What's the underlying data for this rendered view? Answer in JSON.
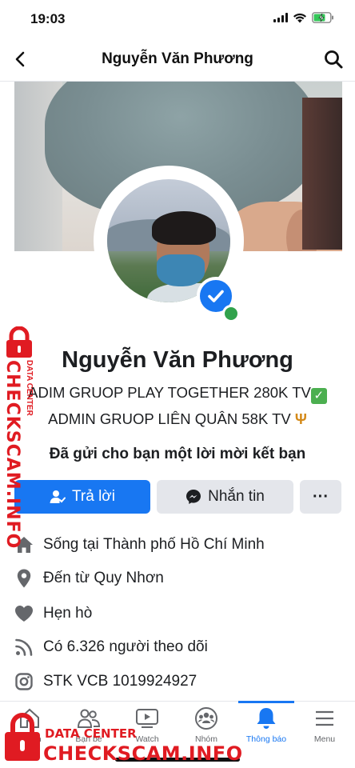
{
  "status_bar": {
    "time": "19:03"
  },
  "nav": {
    "title": "Nguyễn Văn Phương"
  },
  "profile": {
    "name": "Nguyễn Văn Phương",
    "bio_line1": "ADIM GRUOP PLAY TOGETHER 280K TV",
    "bio_line2": "ADMIN GRUOP LIÊN QUÂN 58K TV",
    "friend_request_text": "Đã gửi cho bạn một lời mời kết bạn"
  },
  "actions": {
    "reply_label": "Trả lời",
    "message_label": "Nhắn tin",
    "more_label": "···"
  },
  "details": [
    {
      "icon": "home-icon",
      "prefix": "Sống tại ",
      "value": "Thành phố Hồ Chí Minh"
    },
    {
      "icon": "location-pin-icon",
      "prefix": "Đến từ ",
      "value": "Quy Nhơn"
    },
    {
      "icon": "heart-icon",
      "prefix": "",
      "value": "Hẹn hò"
    },
    {
      "icon": "rss-icon",
      "prefix": "",
      "value": "Có 6.326 người theo dõi"
    },
    {
      "icon": "instagram-icon",
      "prefix": "",
      "value": "STK VCB 1019924927"
    }
  ],
  "tabs": [
    {
      "label": "tin",
      "icon": "home-icon"
    },
    {
      "label": "Bạn bè",
      "icon": "friends-icon"
    },
    {
      "label": "Watch",
      "icon": "watch-icon"
    },
    {
      "label": "Nhóm",
      "icon": "groups-icon"
    },
    {
      "label": "Thông báo",
      "icon": "bell-icon",
      "active": true
    },
    {
      "label": "Menu",
      "icon": "menu-icon"
    }
  ],
  "watermark": {
    "side_text": "CHECKSCAM.INFO",
    "side_small": "DATA CENTER",
    "bottom_small": "DATA CENTER",
    "bottom_big": "CHECKSCAM.INFO"
  },
  "colors": {
    "accent": "#1877f2",
    "watermark": "#e01b22",
    "online": "#31a24c"
  }
}
